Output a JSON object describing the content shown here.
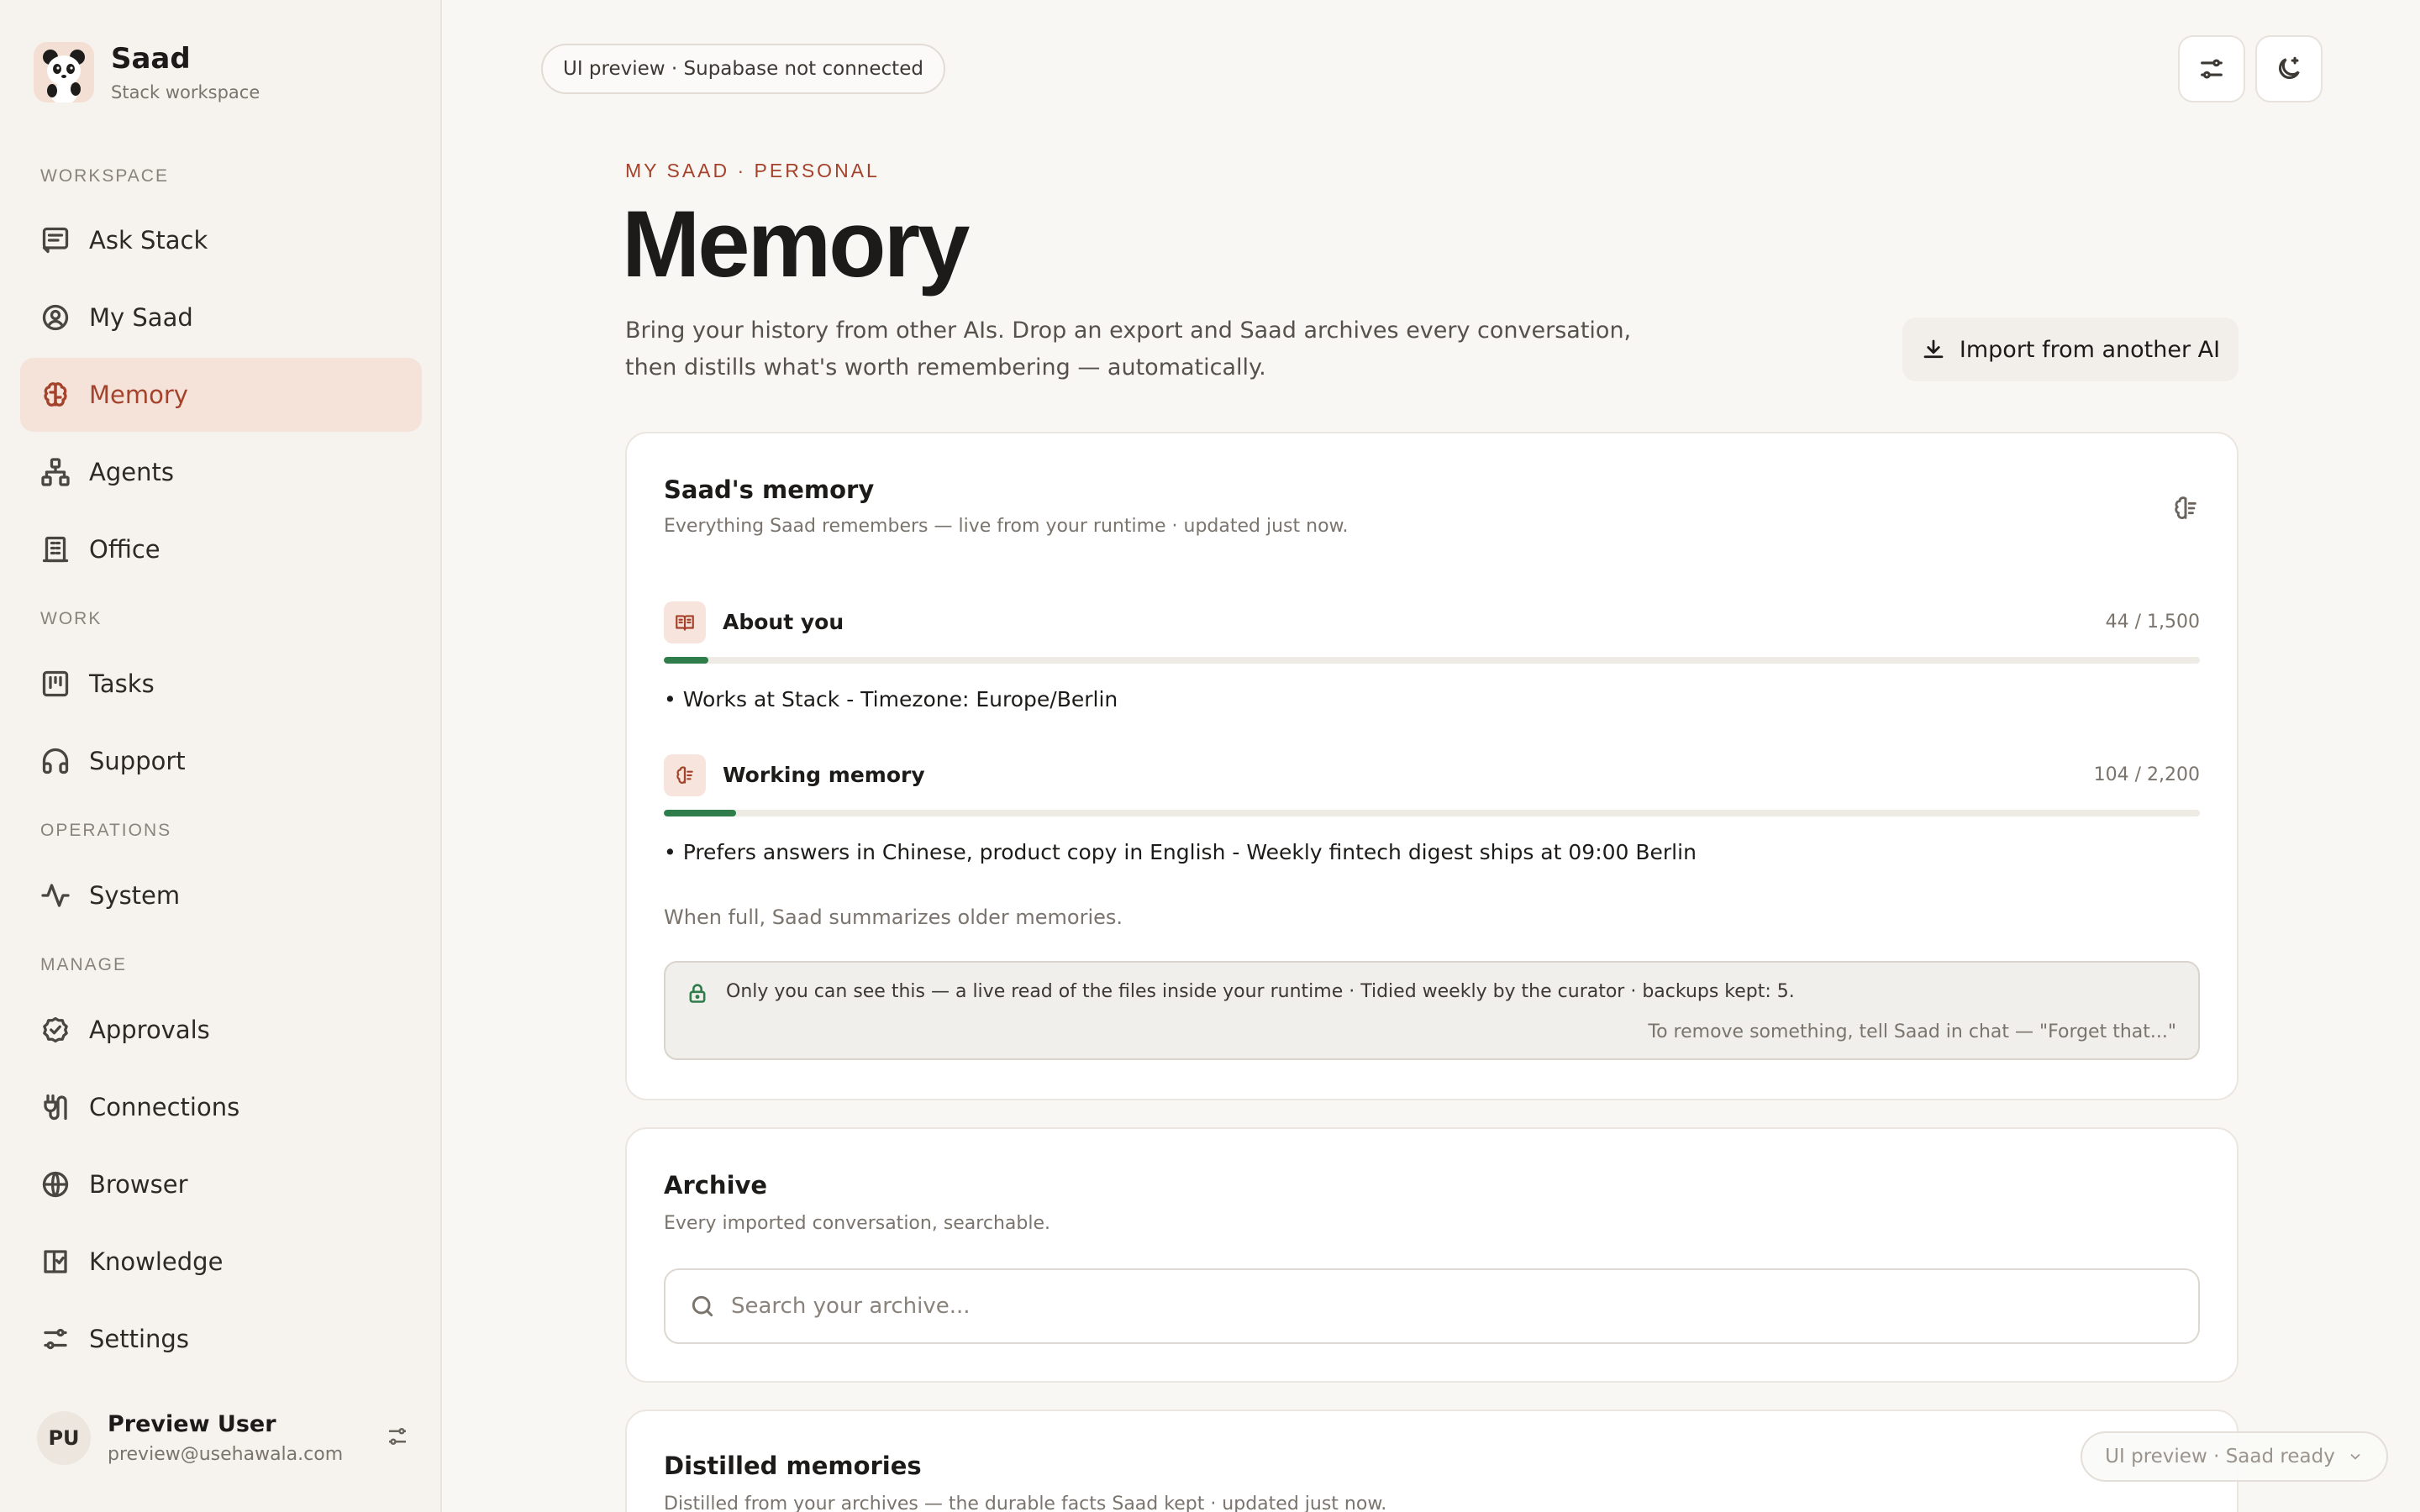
{
  "brand": {
    "name": "Saad",
    "subtitle": "Stack workspace"
  },
  "sidebar": {
    "sections": {
      "workspace": "WORKSPACE",
      "work": "WORK",
      "operations": "OPERATIONS",
      "manage": "MANAGE"
    },
    "items": [
      {
        "label": "Ask Stack",
        "icon": "message-square-icon"
      },
      {
        "label": "My Saad",
        "icon": "user-circle-icon"
      },
      {
        "label": "Memory",
        "icon": "brain-icon",
        "active": true
      },
      {
        "label": "Agents",
        "icon": "network-icon"
      },
      {
        "label": "Office",
        "icon": "building-icon"
      },
      {
        "label": "Tasks",
        "icon": "kanban-icon"
      },
      {
        "label": "Support",
        "icon": "headphones-icon"
      },
      {
        "label": "System",
        "icon": "activity-icon"
      },
      {
        "label": "Approvals",
        "icon": "check-circle-icon"
      },
      {
        "label": "Connections",
        "icon": "plug-icon"
      },
      {
        "label": "Browser",
        "icon": "globe-icon"
      },
      {
        "label": "Knowledge",
        "icon": "book-check-icon"
      },
      {
        "label": "Settings",
        "icon": "sliders-icon"
      }
    ]
  },
  "user": {
    "initials": "PU",
    "name": "Preview User",
    "email": "preview@usehawala.com"
  },
  "header": {
    "preview_pill": "UI preview · Supabase not connected"
  },
  "page": {
    "eyebrow": "MY SAAD · PERSONAL",
    "title": "Memory",
    "description": "Bring your history from other AIs. Drop an export and Saad archives every conversation, then distills what's worth remembering — automatically.",
    "import_button": "Import from another AI"
  },
  "memory_card": {
    "title": "Saad's memory",
    "subtitle": "Everything Saad remembers — live from your runtime · updated just now.",
    "about": {
      "label": "About you",
      "count": "44 / 1,500",
      "progress": 0.029,
      "text": "• Works at Stack - Timezone: Europe/Berlin"
    },
    "working": {
      "label": "Working memory",
      "count": "104 / 2,200",
      "progress": 0.047,
      "text": "• Prefers answers in Chinese, product copy in English - Weekly fintech digest ships at 09:00 Berlin"
    },
    "note": "When full, Saad summarizes older memories.",
    "privacy_line1": "Only you can see this — a live read of the files inside your runtime · Tidied weekly by the curator · backups kept: 5.",
    "privacy_line2": "To remove something, tell Saad in chat — \"Forget that...\""
  },
  "archive_card": {
    "title": "Archive",
    "subtitle": "Every imported conversation, searchable.",
    "search_placeholder": "Search your archive..."
  },
  "distilled_card": {
    "title": "Distilled memories",
    "subtitle": "Distilled from your archives — the durable facts Saad kept · updated just now."
  },
  "status_pill": "UI preview · Saad ready",
  "colors": {
    "accent": "#a4422b",
    "active_bg": "#f5e3da",
    "progress": "#2e7d4a"
  }
}
